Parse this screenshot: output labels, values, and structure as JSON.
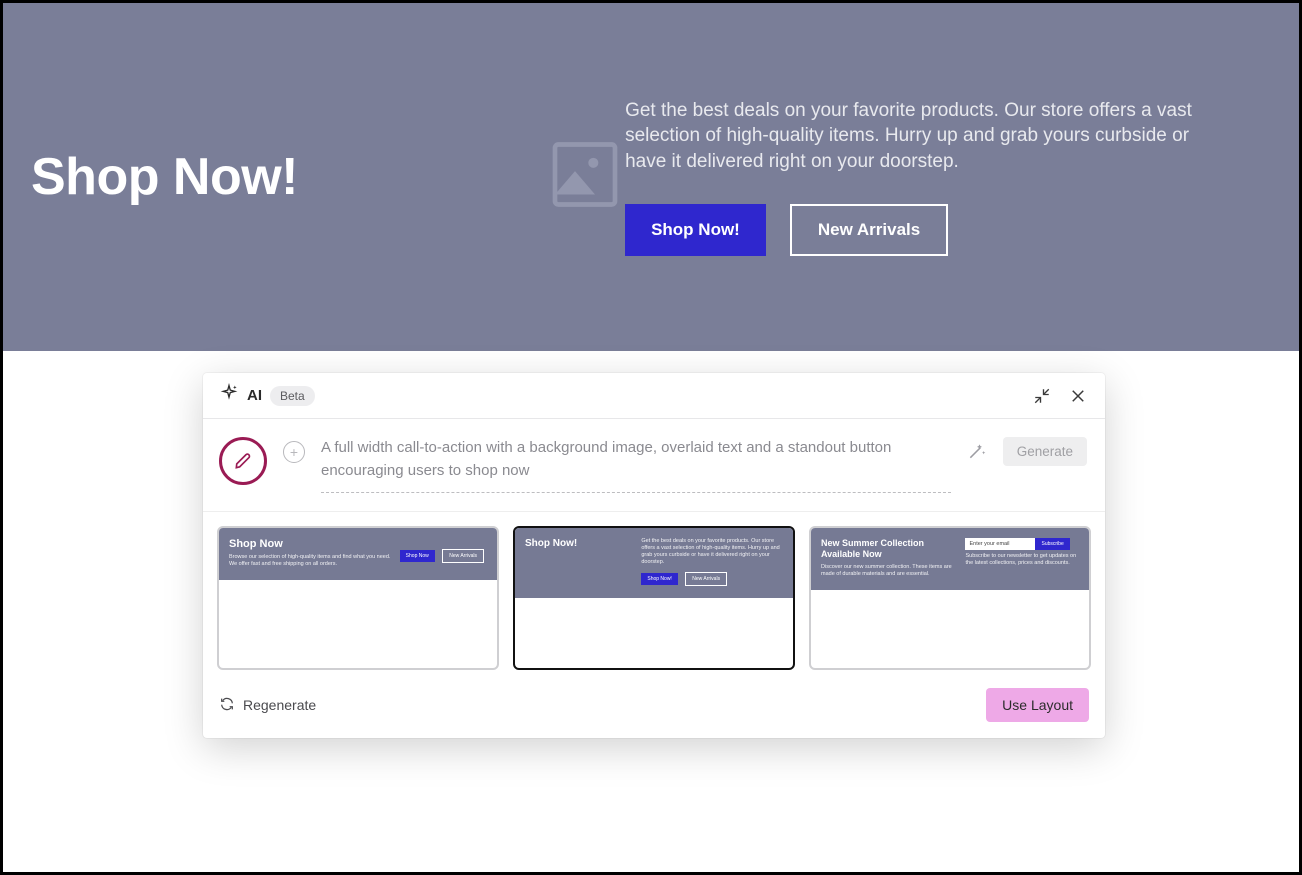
{
  "hero": {
    "title": "Shop Now!",
    "description": "Get the best deals on your favorite products. Our store offers a vast selection of high-quality items. Hurry up and grab yours curbside or have it delivered right on your doorstep.",
    "primary_button": "Shop Now!",
    "secondary_button": "New Arrivals"
  },
  "ai_panel": {
    "label": "AI",
    "badge": "Beta",
    "prompt": "A full width call-to-action with a background image, overlaid text and a standout button encouraging users to shop now",
    "generate_button": "Generate",
    "regenerate_label": "Regenerate",
    "use_layout_button": "Use Layout",
    "thumbnails": [
      {
        "title": "Shop Now",
        "text": "Browse our selection of high-quality items and find what you need. We offer fast and free shipping on all orders.",
        "buttons": [
          "Shop Now",
          "New Arrivals"
        ]
      },
      {
        "title": "Shop Now!",
        "text": "Get the best deals on your favorite products. Our store offers a vast selection of high-quality items. Hurry up and grab yours curbside or have it delivered right on your doorstep.",
        "buttons": [
          "Shop Now!",
          "New Arrivals"
        ]
      },
      {
        "title": "New Summer Collection Available Now",
        "text": "Discover our new summer collection. These items are made of durable materials and are essential.",
        "input_placeholder": "Enter your email",
        "subscribe_button": "Subscribe",
        "sub_text": "Subscribe to our newsletter to get updates on the latest collections, prices and discounts."
      }
    ]
  }
}
